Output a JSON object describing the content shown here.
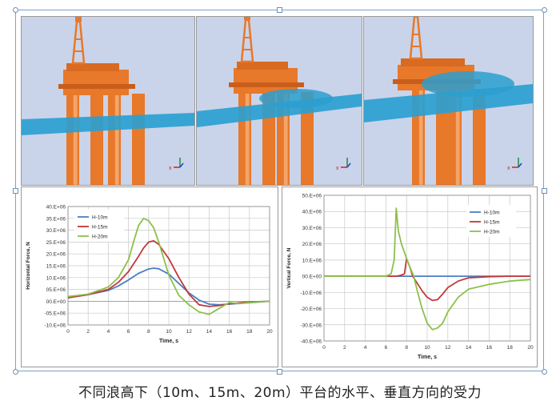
{
  "caption": "不同浪高下（10m、15m、20m）平台的水平、垂直方向的受力",
  "renders": [
    {
      "label": "render-wave-10m",
      "wave_level": "low",
      "axis_label": "x"
    },
    {
      "label": "render-wave-15m",
      "wave_level": "mid",
      "axis_label": "x"
    },
    {
      "label": "render-wave-20m",
      "wave_level": "high",
      "axis_label": "x"
    }
  ],
  "colors": {
    "sky": "#c9d4ea",
    "water": "#2b9fd0",
    "platform": "#e8782a",
    "series_10m": "#4a7fc1",
    "series_15m": "#c0393b",
    "series_20m": "#8dc04a"
  },
  "chart_data": [
    {
      "type": "line",
      "title": "",
      "xlabel": "Time, s",
      "ylabel": "Horizontal Force, N",
      "xlim": [
        0,
        20
      ],
      "ylim": [
        -10,
        40
      ],
      "x_ticks": [
        "0",
        "2",
        "4",
        "6",
        "8",
        "10",
        "12",
        "14",
        "16",
        "18",
        "20"
      ],
      "y_ticks": [
        "40.E+06",
        "35.E+06",
        "30.E+06",
        "25.E+06",
        "20.E+06",
        "15.E+06",
        "10.E+06",
        "05.E+06",
        "00.E+00",
        "-05.E+06",
        "-10.E+06"
      ],
      "y_tick_values": [
        40,
        35,
        30,
        25,
        20,
        15,
        10,
        5,
        0,
        -5,
        -10
      ],
      "legend_position": "top-left",
      "grid": true,
      "series": [
        {
          "name": "H-10m",
          "color_key": "series_10m",
          "x": [
            0,
            2,
            4,
            5,
            6,
            7,
            8,
            8.5,
            9,
            10,
            11,
            12,
            13,
            14,
            15,
            16,
            18,
            20
          ],
          "y": [
            1.5,
            2.8,
            4.6,
            6.5,
            9,
            11.8,
            13.6,
            14,
            13.7,
            11.5,
            7.5,
            3.5,
            0.5,
            -1.2,
            -1.5,
            -1.2,
            -0.6,
            0
          ]
        },
        {
          "name": "H-15m",
          "color_key": "series_15m",
          "x": [
            0,
            2,
            4,
            5,
            6,
            7,
            7.5,
            8,
            8.5,
            9,
            10,
            11,
            12,
            13,
            14,
            15,
            16,
            18,
            20
          ],
          "y": [
            1.5,
            2.8,
            5,
            8,
            12.5,
            19,
            22.5,
            25,
            25.5,
            24,
            18,
            10,
            3,
            -1.5,
            -2.2,
            -1.8,
            -1,
            -0.3,
            0
          ]
        },
        {
          "name": "H-20m",
          "color_key": "series_20m",
          "x": [
            0,
            2,
            4,
            5,
            6,
            6.5,
            7,
            7.5,
            8,
            8.5,
            9,
            9.5,
            10,
            11,
            12,
            13,
            14,
            15,
            16,
            17,
            18,
            20
          ],
          "y": [
            2,
            3,
            6,
            10,
            17.5,
            25,
            32,
            35,
            34,
            31,
            25,
            18,
            11,
            2.5,
            -1.5,
            -4.5,
            -5.5,
            -3,
            -0.5,
            -1,
            -0.5,
            0
          ]
        }
      ]
    },
    {
      "type": "line",
      "title": "",
      "xlabel": "Time, s",
      "ylabel": "Vertical Force, N",
      "xlim": [
        0,
        20
      ],
      "ylim": [
        -40,
        50
      ],
      "x_ticks": [
        "0",
        "2",
        "4",
        "6",
        "8",
        "10",
        "12",
        "14",
        "16",
        "18",
        "20"
      ],
      "y_ticks": [
        "50.E+06",
        "40.E+06",
        "30.E+06",
        "20.E+06",
        "10.E+06",
        "00.E+00",
        "-10.E+06",
        "-20.E+06",
        "-30.E+06",
        "-40.E+06"
      ],
      "y_tick_values": [
        50,
        40,
        30,
        20,
        10,
        0,
        -10,
        -20,
        -30,
        -40
      ],
      "legend_position": "top-right",
      "grid": true,
      "series": [
        {
          "name": "H-10m",
          "color_key": "series_10m",
          "x": [
            0,
            20
          ],
          "y": [
            0,
            0
          ]
        },
        {
          "name": "H-15m",
          "color_key": "series_15m",
          "x": [
            0,
            7,
            7.4,
            7.8,
            8,
            8.3,
            8.6,
            9,
            9.5,
            10,
            10.5,
            11,
            11.5,
            12,
            13,
            14,
            16,
            18,
            20
          ],
          "y": [
            0,
            0,
            0.5,
            1.5,
            11,
            6,
            0,
            -4,
            -9,
            -13,
            -15,
            -14.5,
            -11,
            -7,
            -3,
            -1,
            -0.3,
            0,
            0
          ]
        },
        {
          "name": "H-20m",
          "color_key": "series_20m",
          "x": [
            0,
            6,
            6.5,
            6.8,
            7,
            7.2,
            7.5,
            8,
            8.3,
            8.7,
            9,
            9.5,
            10,
            10.5,
            11,
            11.5,
            12,
            13,
            14,
            16,
            18,
            20
          ],
          "y": [
            0,
            0,
            1.5,
            10,
            42,
            28,
            20,
            11,
            6,
            0,
            -8,
            -20,
            -29,
            -33,
            -32,
            -29,
            -22,
            -13,
            -8,
            -5,
            -3,
            -2
          ]
        }
      ]
    }
  ]
}
